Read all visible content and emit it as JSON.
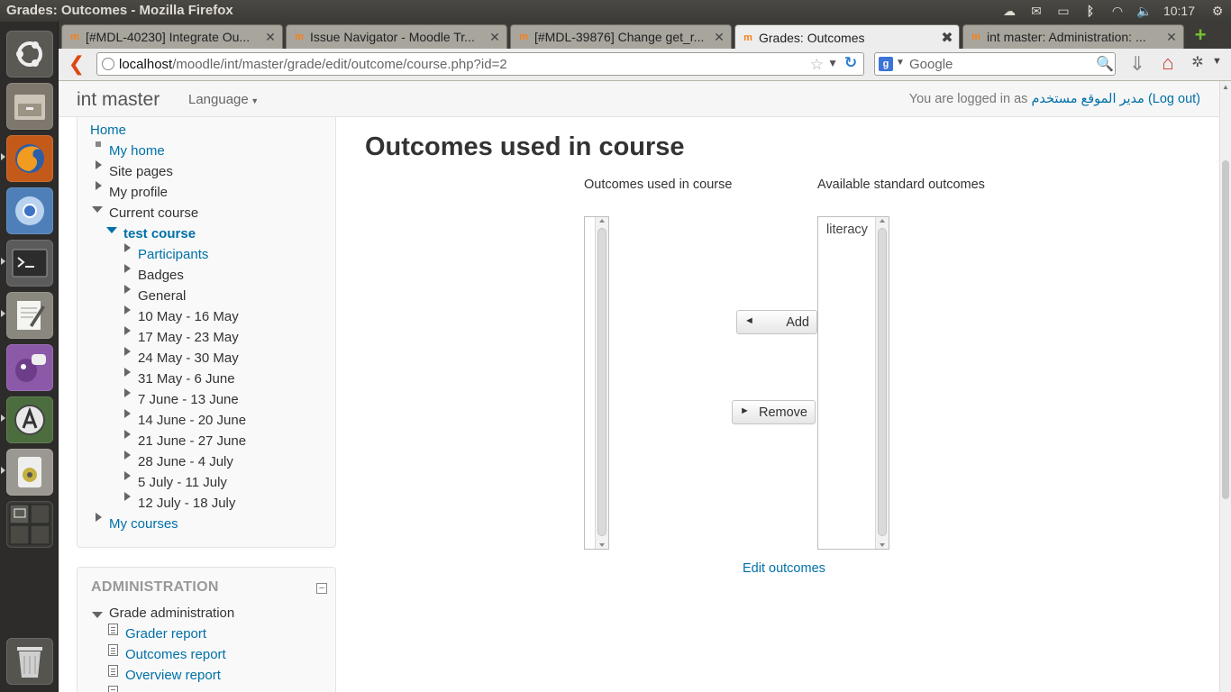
{
  "system": {
    "window_title": "Grades: Outcomes - Mozilla Firefox",
    "clock": "10:17"
  },
  "launcher": {
    "items": [
      "ubuntu-dash",
      "files",
      "firefox",
      "chromium",
      "terminal",
      "text-editor",
      "pidgin",
      "software-updater",
      "audio-player",
      "workspace-switcher",
      "trash"
    ]
  },
  "browser": {
    "tabs": [
      {
        "label": "[#MDL-40230] Integrate Ou...",
        "favicon": "m"
      },
      {
        "label": "Issue Navigator - Moodle Tr...",
        "favicon": "m"
      },
      {
        "label": "[#MDL-39876] Change get_r...",
        "favicon": "m"
      },
      {
        "label": "Grades: Outcomes",
        "favicon": "m",
        "active": true
      },
      {
        "label": "int master: Administration: ...",
        "favicon": "m"
      }
    ],
    "url_host": "localhost",
    "url_path": "/moodle/int/master/grade/edit/outcome/course.php?id=2",
    "search_placeholder": "Google",
    "search_engine_letter": "g"
  },
  "moodle": {
    "site_name": "int master",
    "language_menu": "Language",
    "login_prefix": "You are logged in as ",
    "user_name": "مدير الموقع مستخدم",
    "logout_label": "(Log out)",
    "navigation": {
      "home": "Home",
      "my_home": "My home",
      "site_pages": "Site pages",
      "my_profile": "My profile",
      "current_course": "Current course",
      "course_name": "test course",
      "participants": "Participants",
      "badges": "Badges",
      "general": "General",
      "weeks": [
        "10 May - 16 May",
        "17 May - 23 May",
        "24 May - 30 May",
        "31 May - 6 June",
        "7 June - 13 June",
        "14 June - 20 June",
        "21 June - 27 June",
        "28 June - 4 July",
        "5 July - 11 July",
        "12 July - 18 July"
      ],
      "my_courses": "My courses"
    },
    "administration": {
      "title": "ADMINISTRATION",
      "grade_admin": "Grade administration",
      "items": [
        "Grader report",
        "Outcomes report",
        "Overview report"
      ]
    },
    "main": {
      "page_title": "Outcomes used in course",
      "used_heading": "Outcomes used in course",
      "available_heading": "Available standard outcomes",
      "used_options": [],
      "available_options": [
        "literacy"
      ],
      "add_label": "Add",
      "remove_label": "Remove",
      "edit_link": "Edit outcomes"
    }
  }
}
